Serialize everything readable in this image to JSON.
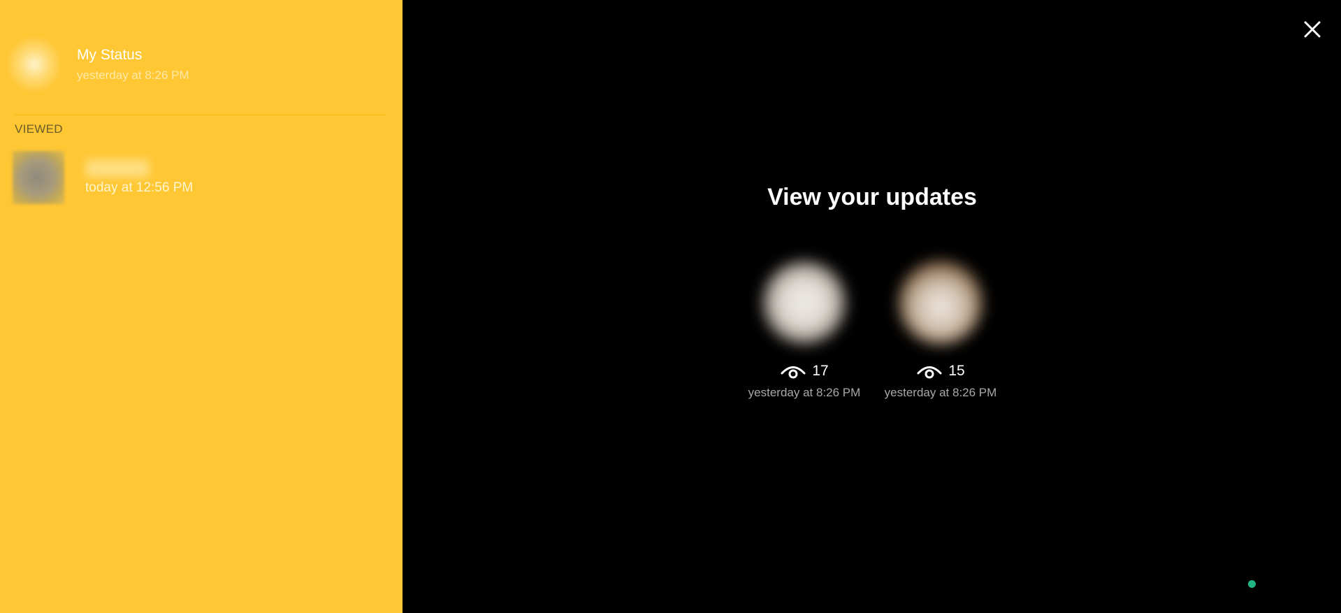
{
  "colors": {
    "sidebar_bg": "#ffc734",
    "viewer_bg": "#000000",
    "status_dot": "#21b584"
  },
  "sidebar": {
    "my_status": {
      "name": "My Status",
      "time": "yesterday at 8:26 PM",
      "avatar_icon": "blurred-avatar"
    },
    "section_label": "VIEWED",
    "viewed_items": [
      {
        "name": "",
        "time": "today at 12:56 PM",
        "avatar_icon": "blurred-avatar"
      }
    ]
  },
  "viewer": {
    "close_icon": "close-icon",
    "title": "View your updates",
    "updates": [
      {
        "views": "17",
        "time": "yesterday at 8:26 PM",
        "view_icon": "eye-icon"
      },
      {
        "views": "15",
        "time": "yesterday at 8:26 PM",
        "view_icon": "eye-icon"
      }
    ]
  }
}
